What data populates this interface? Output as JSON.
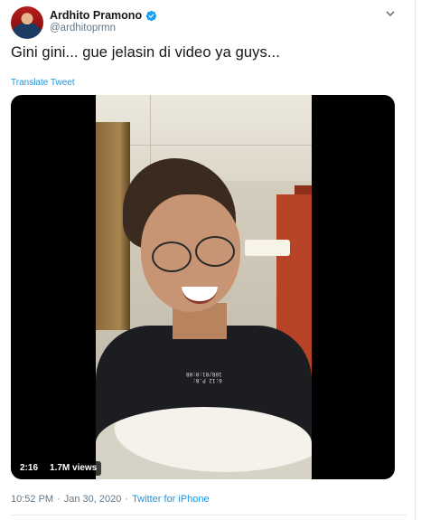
{
  "author": {
    "display_name": "Ardhito Pramono",
    "handle": "@ardhitoprmn",
    "verified": true
  },
  "tweet": {
    "text": "Gini gini... gue jelasin di video ya guys...",
    "translate_label": "Translate Tweet"
  },
  "media": {
    "type": "video",
    "duration": "2:16",
    "views": "1.7M views",
    "shirt_print": "6:12 P.8:\n108/01:0:08"
  },
  "meta": {
    "time": "10:52 PM",
    "separator1": "·",
    "date": "Jan 30, 2020",
    "separator2": "·",
    "source": "Twitter for iPhone"
  },
  "colors": {
    "link": "#1b95e0",
    "secondary_text": "#657786",
    "primary_text": "#14171a",
    "verified_badge": "#1da1f2"
  },
  "icons": {
    "verified": "verified-badge-icon",
    "menu": "chevron-down-icon"
  }
}
